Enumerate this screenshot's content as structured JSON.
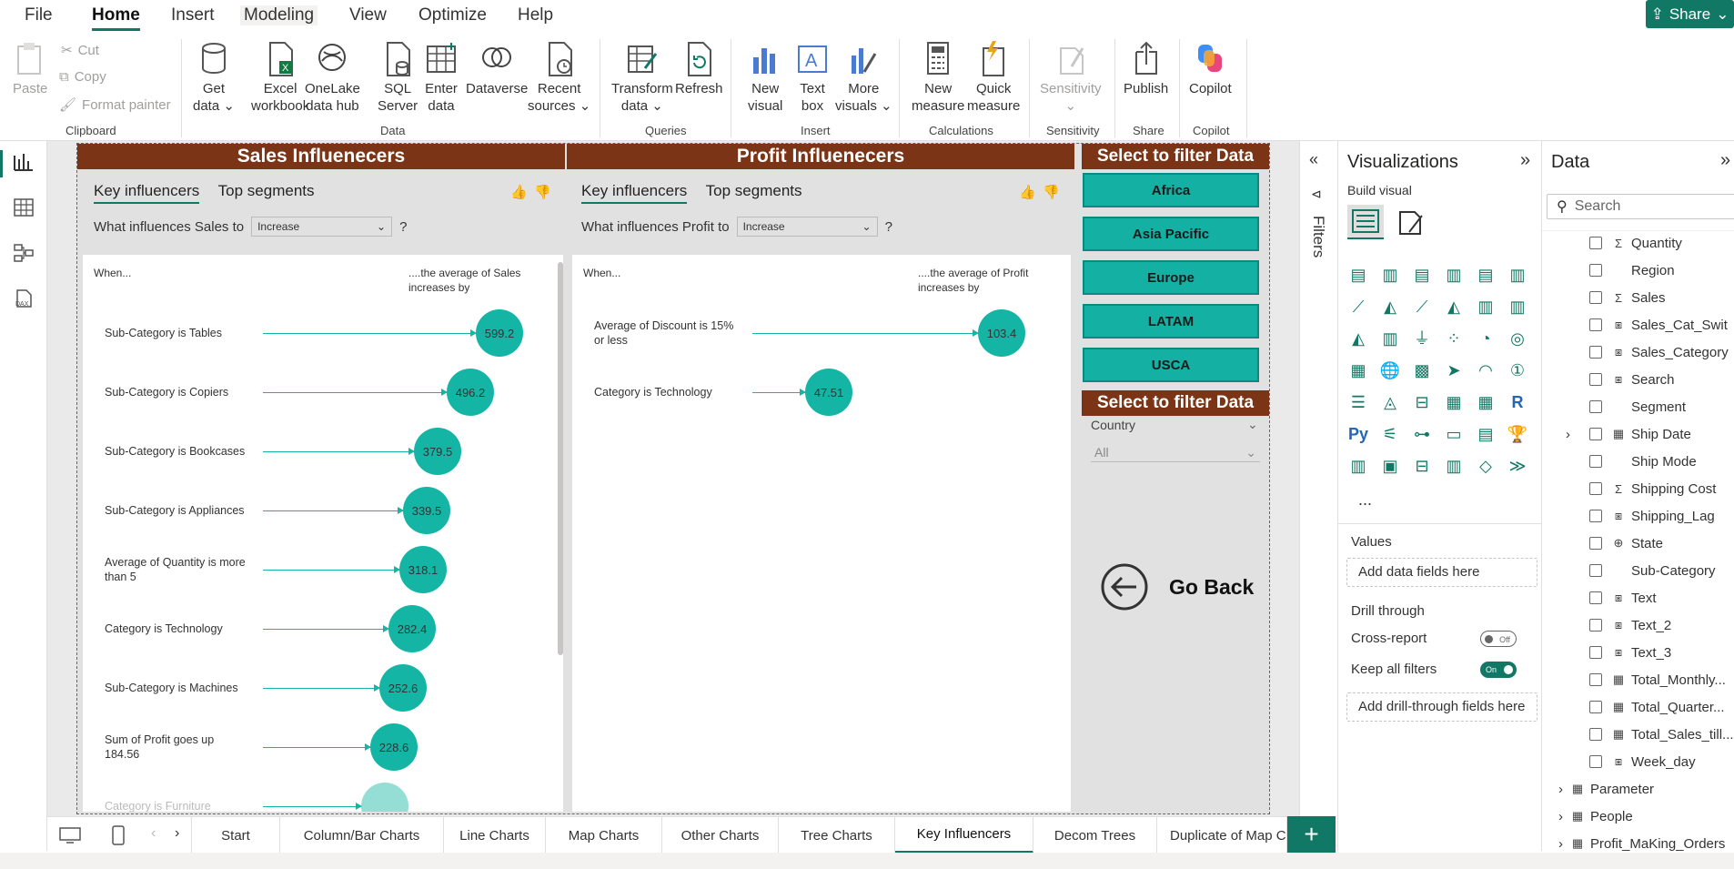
{
  "menu": {
    "items": [
      "File",
      "Home",
      "Insert",
      "Modeling",
      "View",
      "Optimize",
      "Help"
    ],
    "active": "Home",
    "share": "Share"
  },
  "ribbon": {
    "clipboard": {
      "paste": "Paste",
      "cut": "Cut",
      "copy": "Copy",
      "format_painter": "Format painter",
      "label": "Clipboard"
    },
    "data": {
      "get_data": [
        "Get",
        "data"
      ],
      "excel": [
        "Excel",
        "workbook"
      ],
      "onelake": [
        "OneLake",
        "data hub"
      ],
      "sql": [
        "SQL",
        "Server"
      ],
      "enter": [
        "Enter",
        "data"
      ],
      "dataverse": "Dataverse",
      "recent": [
        "Recent",
        "sources"
      ],
      "label": "Data"
    },
    "queries": {
      "transform": [
        "Transform",
        "data"
      ],
      "refresh": "Refresh",
      "label": "Queries"
    },
    "insert": {
      "new_visual": [
        "New",
        "visual"
      ],
      "text_box": [
        "Text",
        "box"
      ],
      "more_visuals": [
        "More",
        "visuals"
      ],
      "label": "Insert"
    },
    "calculations": {
      "new_measure": [
        "New",
        "measure"
      ],
      "quick_measure": [
        "Quick",
        "measure"
      ],
      "label": "Calculations"
    },
    "sensitivity": {
      "sensitivity": "Sensitivity",
      "label": "Sensitivity"
    },
    "share": {
      "publish": "Publish",
      "label": "Share"
    },
    "copilot": {
      "copilot": "Copilot",
      "label": "Copilot"
    }
  },
  "report": {
    "sales_header": "Sales Influenecers",
    "profit_header": "Profit Influenecers",
    "filter_header": "Select to filter Data",
    "filter_header_2": "Select to filter Data",
    "tabs": {
      "key": "Key influencers",
      "top": "Top segments"
    },
    "sales_question": "What influences Sales to",
    "profit_question": "What influences Profit to",
    "dropdown_value": "Increase",
    "question_mark": "?",
    "when": "When...",
    "sales_avg_header": [
      "....the average of Sales",
      "increases by"
    ],
    "profit_avg_header": [
      "....the average of Profit",
      "increases by"
    ],
    "sales_influencers": [
      {
        "label": "Sub-Category is Tables",
        "value": "599.2"
      },
      {
        "label": "Sub-Category is Copiers",
        "value": "496.2"
      },
      {
        "label": "Sub-Category is Bookcases",
        "value": "379.5"
      },
      {
        "label": "Sub-Category is Appliances",
        "value": "339.5"
      },
      {
        "label": "Average of Quantity is more than 5",
        "value": "318.1"
      },
      {
        "label": "Category is Technology",
        "value": "282.4"
      },
      {
        "label": "Sub-Category is Machines",
        "value": "252.6"
      },
      {
        "label": "Sum of Profit goes up 184.56",
        "value": "228.6"
      },
      {
        "label": "Category is Furniture",
        "value": ""
      }
    ],
    "profit_influencers": [
      {
        "label": "Average of Discount is 15% or less",
        "value": "103.4"
      },
      {
        "label": "Category is Technology",
        "value": "47.51"
      }
    ],
    "regions": [
      "Africa",
      "Asia Pacific",
      "Europe",
      "LATAM",
      "USCA"
    ],
    "country_slicer": {
      "label": "Country",
      "value": "All"
    },
    "go_back": "Go Back"
  },
  "filters_label": "Filters",
  "visualizations": {
    "title": "Visualizations",
    "build_visual": "Build visual",
    "values": "Values",
    "values_placeholder": "Add data fields here",
    "drill_through": "Drill through",
    "cross_report": "Cross-report",
    "cross_report_state": "Off",
    "keep_all_filters": "Keep all filters",
    "keep_state": "On",
    "drill_placeholder": "Add drill-through fields here",
    "more": "..."
  },
  "data_pane": {
    "title": "Data",
    "search_placeholder": "Search",
    "fields": [
      {
        "name": "Quantity",
        "icon": "sigma"
      },
      {
        "name": "Region",
        "icon": ""
      },
      {
        "name": "Sales",
        "icon": "sigma"
      },
      {
        "name": "Sales_Cat_Swit",
        "icon": "measure"
      },
      {
        "name": "Sales_Category",
        "icon": "measure"
      },
      {
        "name": "Search",
        "icon": "measure"
      },
      {
        "name": "Segment",
        "icon": ""
      },
      {
        "name": "Ship Date",
        "icon": "calendar"
      },
      {
        "name": "Ship Mode",
        "icon": ""
      },
      {
        "name": "Shipping Cost",
        "icon": "sigma"
      },
      {
        "name": "Shipping_Lag",
        "icon": "measure"
      },
      {
        "name": "State",
        "icon": "globe"
      },
      {
        "name": "Sub-Category",
        "icon": ""
      },
      {
        "name": "Text",
        "icon": "measure"
      },
      {
        "name": "Text_2",
        "icon": "measure"
      },
      {
        "name": "Text_3",
        "icon": "measure"
      },
      {
        "name": "Total_Monthly...",
        "icon": "calc"
      },
      {
        "name": "Total_Quarter...",
        "icon": "calc"
      },
      {
        "name": "Total_Sales_till...",
        "icon": "calc"
      },
      {
        "name": "Week_day",
        "icon": "measure"
      }
    ],
    "tables": [
      "Parameter",
      "People",
      "Profit_MaKing_Orders"
    ]
  },
  "pages": [
    "Start",
    "Column/Bar Charts",
    "Line Charts",
    "Map Charts",
    "Other Charts",
    "Tree Charts",
    "Key Influencers",
    "Decom Trees",
    "Duplicate of Map C"
  ],
  "active_page": "Key Influencers",
  "colors": {
    "accent": "#117865",
    "header_brown": "#7b3416",
    "bubble_teal": "#14b5a5",
    "slicer_teal": "#13b0a3"
  }
}
